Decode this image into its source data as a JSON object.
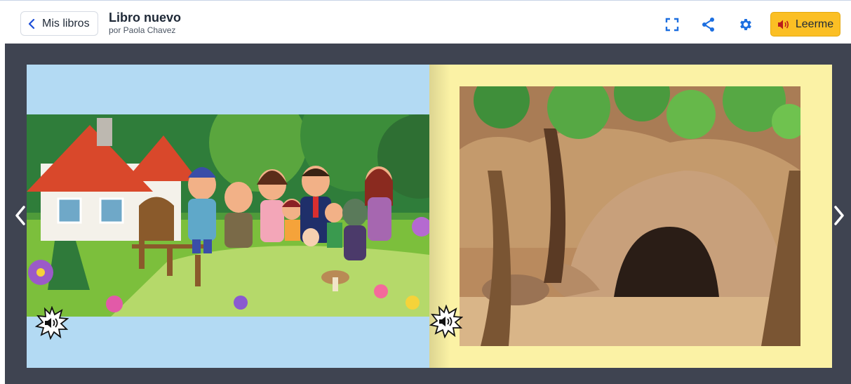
{
  "header": {
    "back_label": "Mis libros",
    "title": "Libro nuevo",
    "author": "por Paola Chavez",
    "read_label": "Leerme",
    "icons": [
      "chevron-left-icon",
      "fullscreen-icon",
      "share-icon",
      "gear-icon",
      "speaker-icon"
    ]
  },
  "reader": {
    "left_page": {
      "background": "#b3daf3",
      "illustration": "family-in-front-of-cottage"
    },
    "right_page": {
      "background": "#fbf2a5",
      "illustration": "cave-in-forest"
    },
    "nav": [
      "prev-page-arrow",
      "next-page-arrow"
    ]
  },
  "colors": {
    "accent": "#fbbf24",
    "icon_blue": "#1d6fe0",
    "stage": "#3f4451"
  }
}
